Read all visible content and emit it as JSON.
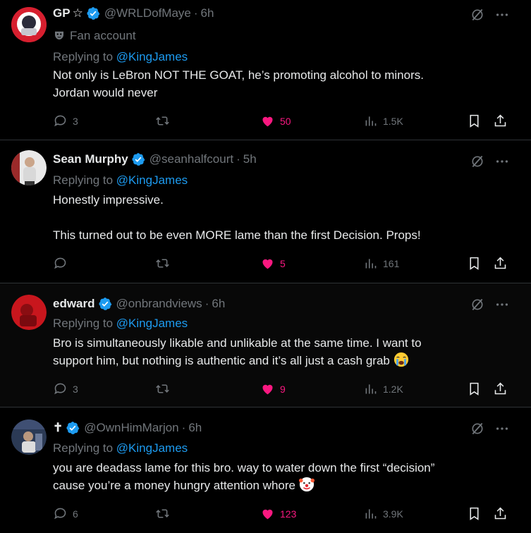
{
  "tweets": [
    {
      "name": "GP",
      "name_suffix": "☆",
      "handle": "@WRLDofMaye",
      "time": "6h",
      "label": "Fan account",
      "replying_prefix": "Replying to",
      "replying_to": "@KingJames",
      "lines": [
        "Not only is LeBron NOT THE GOAT, he’s promoting alcohol to minors.",
        "Jordan would never"
      ],
      "replies": "3",
      "retweets": "",
      "likes": "50",
      "views": "1.5K"
    },
    {
      "name": "Sean Murphy",
      "handle": "@seanhalfcourt",
      "time": "5h",
      "replying_prefix": "Replying to",
      "replying_to": "@KingJames",
      "lines": [
        "Honestly impressive.",
        "This turned out to be even MORE lame than the first Decision. Props!"
      ],
      "replies": "",
      "retweets": "",
      "likes": "5",
      "views": "161"
    },
    {
      "name": "edward",
      "handle": "@onbrandviews",
      "time": "6h",
      "replying_prefix": "Replying to",
      "replying_to": "@KingJames",
      "lines": [
        "Bro is simultaneously likable and unlikable at the same time. I want to",
        "support him, but nothing is authentic and it’s all just a cash grab"
      ],
      "emoji": "crying-face",
      "replies": "3",
      "retweets": "",
      "likes": "9",
      "views": "1.2K"
    },
    {
      "name": "✝",
      "handle": "@OwnHimMarjon",
      "time": "6h",
      "replying_prefix": "Replying to",
      "replying_to": "@KingJames",
      "lines": [
        "you are deadass lame for this bro. way to water down the first “decision”",
        "cause you’re a money hungry attention whore"
      ],
      "emoji": "clown-face",
      "replies": "6",
      "retweets": "",
      "likes": "123",
      "views": "3.9K"
    }
  ],
  "colors": {
    "accent": "#1d9bf0",
    "like": "#f91880",
    "muted": "#71767b",
    "text": "#e7e9ea",
    "border": "#2f3336"
  }
}
